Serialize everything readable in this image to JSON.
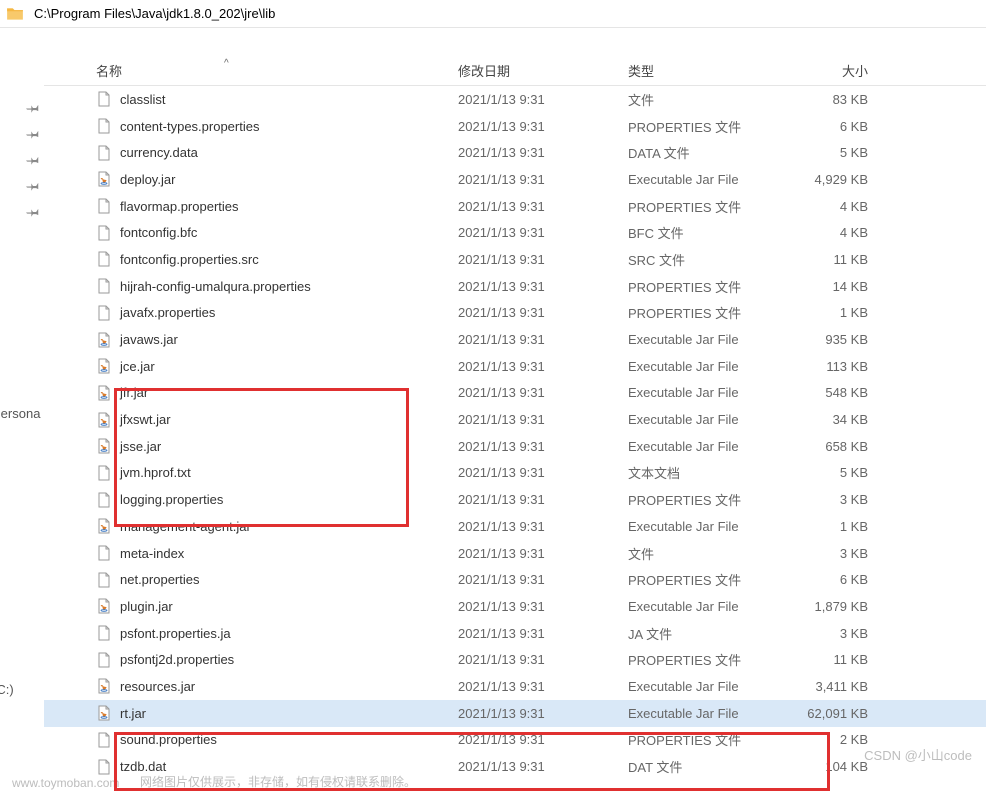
{
  "address": "C:\\Program Files\\Java\\jdk1.8.0_202\\jre\\lib",
  "sidebar": {
    "label_persona": "Persona",
    "label_c": "(C:)"
  },
  "columns": {
    "name": "名称",
    "date": "修改日期",
    "type": "类型",
    "size": "大小",
    "sort_indicator": "^"
  },
  "files": [
    {
      "icon": "file",
      "name": "classlist",
      "date": "2021/1/13 9:31",
      "type": "文件",
      "size": "83 KB",
      "selected": false
    },
    {
      "icon": "file",
      "name": "content-types.properties",
      "date": "2021/1/13 9:31",
      "type": "PROPERTIES 文件",
      "size": "6 KB",
      "selected": false
    },
    {
      "icon": "file",
      "name": "currency.data",
      "date": "2021/1/13 9:31",
      "type": "DATA 文件",
      "size": "5 KB",
      "selected": false
    },
    {
      "icon": "jar",
      "name": "deploy.jar",
      "date": "2021/1/13 9:31",
      "type": "Executable Jar File",
      "size": "4,929 KB",
      "selected": false
    },
    {
      "icon": "file",
      "name": "flavormap.properties",
      "date": "2021/1/13 9:31",
      "type": "PROPERTIES 文件",
      "size": "4 KB",
      "selected": false
    },
    {
      "icon": "file",
      "name": "fontconfig.bfc",
      "date": "2021/1/13 9:31",
      "type": "BFC 文件",
      "size": "4 KB",
      "selected": false
    },
    {
      "icon": "file",
      "name": "fontconfig.properties.src",
      "date": "2021/1/13 9:31",
      "type": "SRC 文件",
      "size": "11 KB",
      "selected": false
    },
    {
      "icon": "file",
      "name": "hijrah-config-umalqura.properties",
      "date": "2021/1/13 9:31",
      "type": "PROPERTIES 文件",
      "size": "14 KB",
      "selected": false
    },
    {
      "icon": "file",
      "name": "javafx.properties",
      "date": "2021/1/13 9:31",
      "type": "PROPERTIES 文件",
      "size": "1 KB",
      "selected": false
    },
    {
      "icon": "jar",
      "name": "javaws.jar",
      "date": "2021/1/13 9:31",
      "type": "Executable Jar File",
      "size": "935 KB",
      "selected": false
    },
    {
      "icon": "jar",
      "name": "jce.jar",
      "date": "2021/1/13 9:31",
      "type": "Executable Jar File",
      "size": "113 KB",
      "selected": false
    },
    {
      "icon": "jar",
      "name": "jfr.jar",
      "date": "2021/1/13 9:31",
      "type": "Executable Jar File",
      "size": "548 KB",
      "selected": false
    },
    {
      "icon": "jar",
      "name": "jfxswt.jar",
      "date": "2021/1/13 9:31",
      "type": "Executable Jar File",
      "size": "34 KB",
      "selected": false
    },
    {
      "icon": "jar",
      "name": "jsse.jar",
      "date": "2021/1/13 9:31",
      "type": "Executable Jar File",
      "size": "658 KB",
      "selected": false
    },
    {
      "icon": "file",
      "name": "jvm.hprof.txt",
      "date": "2021/1/13 9:31",
      "type": "文本文档",
      "size": "5 KB",
      "selected": false
    },
    {
      "icon": "file",
      "name": "logging.properties",
      "date": "2021/1/13 9:31",
      "type": "PROPERTIES 文件",
      "size": "3 KB",
      "selected": false
    },
    {
      "icon": "jar",
      "name": "management-agent.jar",
      "date": "2021/1/13 9:31",
      "type": "Executable Jar File",
      "size": "1 KB",
      "selected": false
    },
    {
      "icon": "file",
      "name": "meta-index",
      "date": "2021/1/13 9:31",
      "type": "文件",
      "size": "3 KB",
      "selected": false
    },
    {
      "icon": "file",
      "name": "net.properties",
      "date": "2021/1/13 9:31",
      "type": "PROPERTIES 文件",
      "size": "6 KB",
      "selected": false
    },
    {
      "icon": "jar",
      "name": "plugin.jar",
      "date": "2021/1/13 9:31",
      "type": "Executable Jar File",
      "size": "1,879 KB",
      "selected": false
    },
    {
      "icon": "file",
      "name": "psfont.properties.ja",
      "date": "2021/1/13 9:31",
      "type": "JA 文件",
      "size": "3 KB",
      "selected": false
    },
    {
      "icon": "file",
      "name": "psfontj2d.properties",
      "date": "2021/1/13 9:31",
      "type": "PROPERTIES 文件",
      "size": "11 KB",
      "selected": false
    },
    {
      "icon": "jar",
      "name": "resources.jar",
      "date": "2021/1/13 9:31",
      "type": "Executable Jar File",
      "size": "3,411 KB",
      "selected": false
    },
    {
      "icon": "jar",
      "name": "rt.jar",
      "date": "2021/1/13 9:31",
      "type": "Executable Jar File",
      "size": "62,091 KB",
      "selected": true
    },
    {
      "icon": "file",
      "name": "sound.properties",
      "date": "2021/1/13 9:31",
      "type": "PROPERTIES 文件",
      "size": "2 KB",
      "selected": false
    },
    {
      "icon": "file",
      "name": "tzdb.dat",
      "date": "2021/1/13 9:31",
      "type": "DAT 文件",
      "size": "104 KB",
      "selected": false
    }
  ],
  "watermarks": {
    "left": "www.toymoban.com",
    "note": "网络图片仅供展示，非存储，如有侵权请联系删除。",
    "right": "CSDN @小山code"
  }
}
